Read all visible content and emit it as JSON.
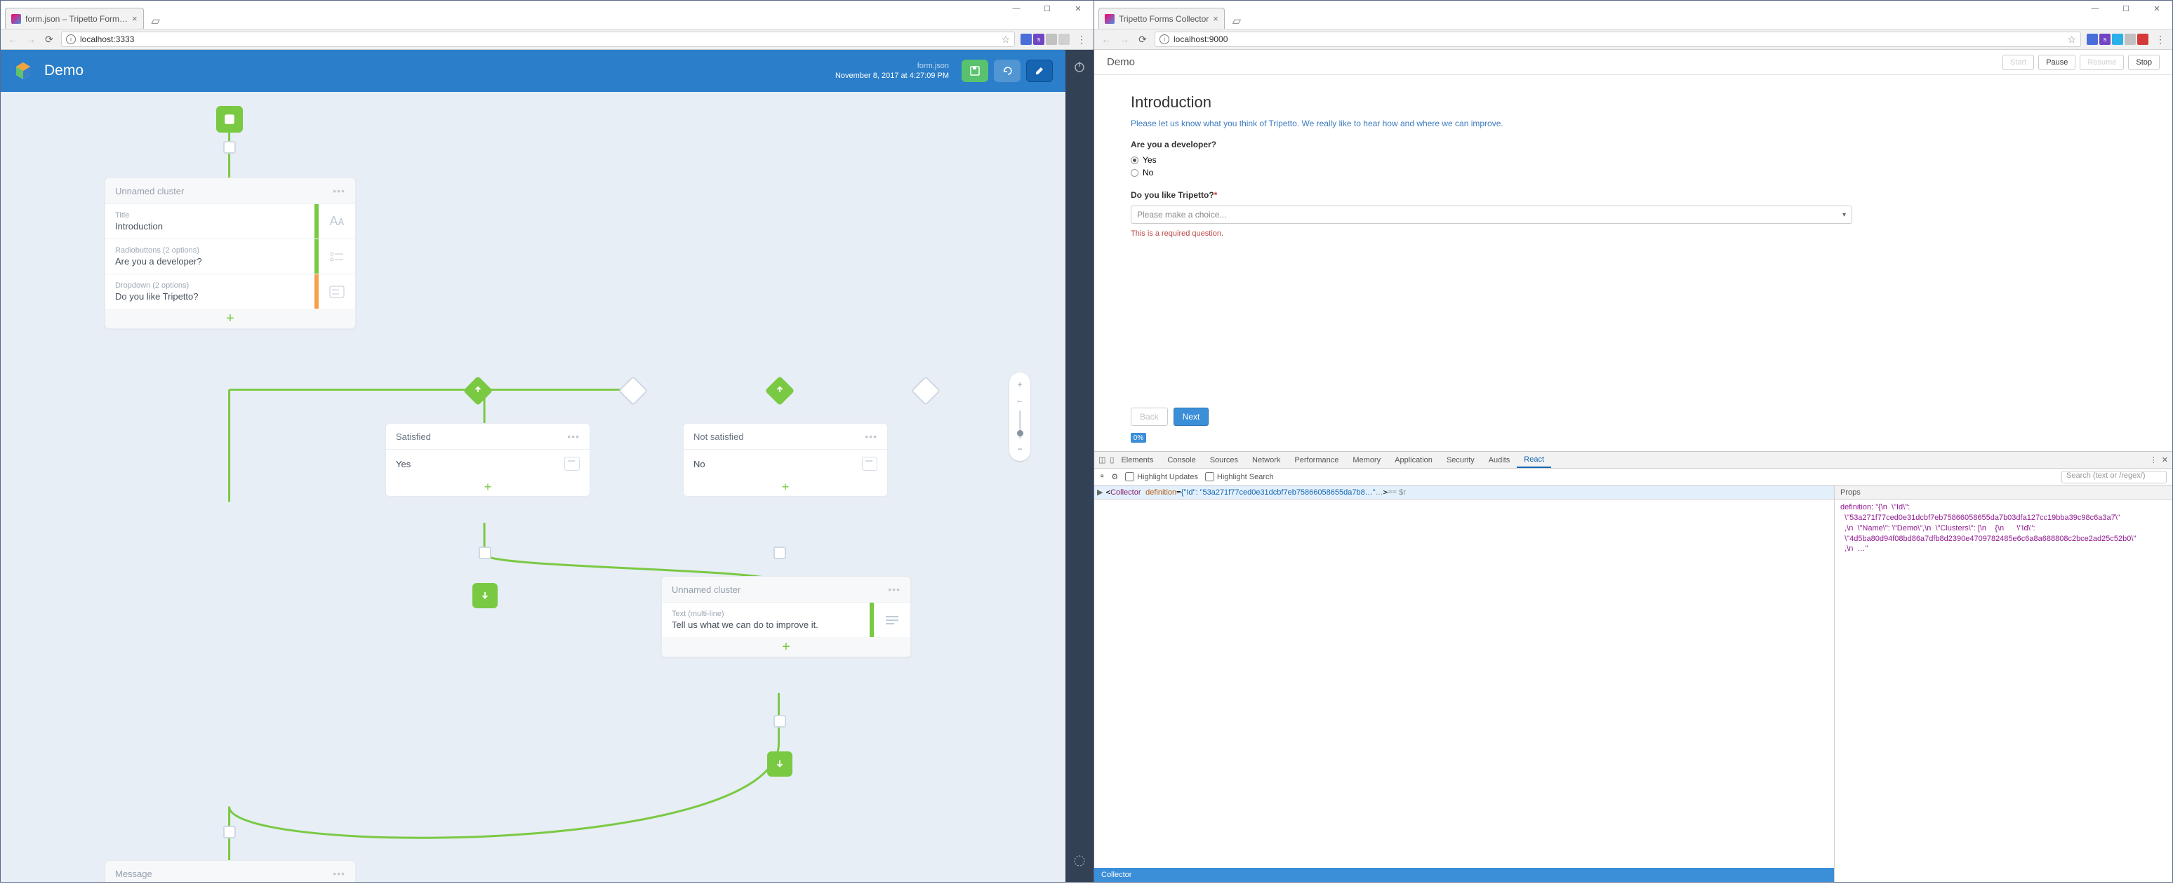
{
  "left": {
    "tab_title": "form.json – Tripetto Form…",
    "url": "localhost:3333",
    "header": {
      "title": "Demo",
      "file": "form.json",
      "date": "November 8, 2017 at 4:27:09 PM"
    },
    "cluster1": {
      "title": "Unnamed cluster",
      "rows": [
        {
          "sub": "Title",
          "label": "Introduction"
        },
        {
          "sub": "Radiobuttons (2 options)",
          "label": "Are you a developer?"
        },
        {
          "sub": "Dropdown (2 options)",
          "label": "Do you like Tripetto?"
        }
      ]
    },
    "branch_yes": {
      "title": "Satisfied",
      "answer": "Yes"
    },
    "branch_no": {
      "title": "Not satisfied",
      "answer": "No"
    },
    "cluster2": {
      "title": "Unnamed cluster",
      "row_sub": "Text (multi-line)",
      "row_label": "Tell us what we can do to improve it."
    },
    "cluster3": {
      "title": "Message"
    },
    "zoom": {
      "plus": "+",
      "minus": "−"
    }
  },
  "right": {
    "tab_title": "Tripetto Forms Collector",
    "url": "localhost:9000",
    "collector": {
      "title": "Demo",
      "controls": {
        "start": "Start",
        "pause": "Pause",
        "resume": "Resume",
        "stop": "Stop"
      },
      "heading": "Introduction",
      "intro": "Please let us know what you think of Tripetto. We really like to hear how and where we can improve.",
      "q1_label": "Are you a developer?",
      "q1_options": [
        "Yes",
        "No"
      ],
      "q2_label": "Do you like Tripetto?",
      "q2_placeholder": "Please make a choice...",
      "required_msg": "This is a required question.",
      "back": "Back",
      "next": "Next",
      "progress": "0%"
    },
    "devtools": {
      "tabs": [
        "Elements",
        "Console",
        "Sources",
        "Network",
        "Performance",
        "Memory",
        "Application",
        "Security",
        "Audits",
        "React"
      ],
      "highlight_updates": "Highlight Updates",
      "highlight_search": "Highlight Search",
      "search_placeholder": "Search (text or /regex/)",
      "tree_tag": "Collector",
      "tree_attr": "definition",
      "tree_val": "{\"Id\": \"53a271f77ced0e31dcbf7eb75866058655da7b8…\"",
      "tree_aux1": "…",
      "tree_aux2": " == $r",
      "props_title": "Props",
      "props_body": "definition: \"{\\n  \\\"Id\\\":\n  \\\"53a271f77ced0e31dcbf7eb75866058655da7b03dfa127cc19bba39c98c6a3a7\\\"\n  ,\\n  \\\"Name\\\": \\\"Demo\\\",\\n  \\\"Clusters\\\": [\\n    {\\n      \\\"Id\\\":\n  \\\"4d5ba80d94f08bd86a7dfb8d2390e4709782485e6c6a8a688808c2bce2ad25c52b0\\\"\n  ,\\n  …\"",
      "status": "Collector"
    }
  }
}
